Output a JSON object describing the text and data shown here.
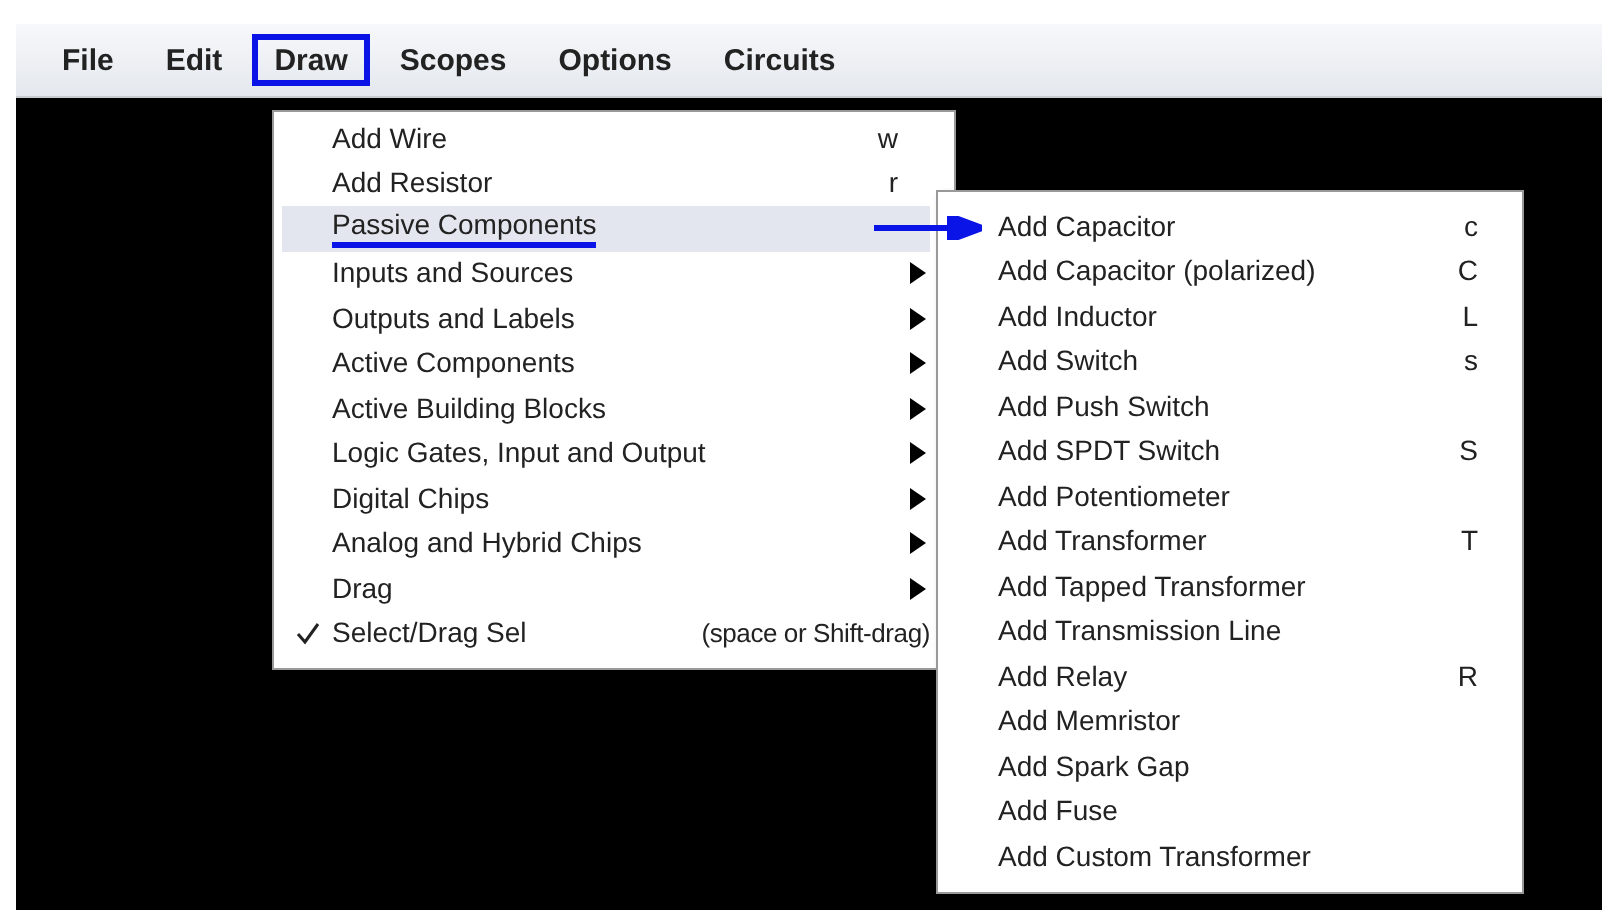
{
  "menubar": [
    {
      "label": "File",
      "selected": false
    },
    {
      "label": "Edit",
      "selected": false
    },
    {
      "label": "Draw",
      "selected": true
    },
    {
      "label": "Scopes",
      "selected": false
    },
    {
      "label": "Options",
      "selected": false
    },
    {
      "label": "Circuits",
      "selected": false
    }
  ],
  "draw_menu": [
    {
      "kind": "shortcut",
      "label": "Add Wire",
      "shortcut": "w",
      "selected": false
    },
    {
      "kind": "shortcut",
      "label": "Add Resistor",
      "shortcut": "r",
      "selected": false
    },
    {
      "kind": "submenu",
      "label": "Passive Components",
      "selected": true
    },
    {
      "kind": "submenu",
      "label": "Inputs and Sources",
      "selected": false
    },
    {
      "kind": "submenu",
      "label": "Outputs and Labels",
      "selected": false
    },
    {
      "kind": "submenu",
      "label": "Active Components",
      "selected": false
    },
    {
      "kind": "submenu",
      "label": "Active Building Blocks",
      "selected": false
    },
    {
      "kind": "submenu",
      "label": "Logic Gates, Input and Output",
      "selected": false
    },
    {
      "kind": "submenu",
      "label": "Digital Chips",
      "selected": false
    },
    {
      "kind": "submenu",
      "label": "Analog and Hybrid Chips",
      "selected": false
    },
    {
      "kind": "submenu",
      "label": "Drag",
      "selected": false
    },
    {
      "kind": "check",
      "label": "Select/Drag Sel",
      "shortcut": "(space or Shift-drag)",
      "checked": true,
      "selected": false
    }
  ],
  "passive_components_menu": [
    {
      "label": "Add Capacitor",
      "shortcut": "c"
    },
    {
      "label": "Add Capacitor (polarized)",
      "shortcut": "C"
    },
    {
      "label": "Add Inductor",
      "shortcut": "L"
    },
    {
      "label": "Add Switch",
      "shortcut": "s"
    },
    {
      "label": "Add Push Switch"
    },
    {
      "label": "Add SPDT Switch",
      "shortcut": "S"
    },
    {
      "label": "Add Potentiometer"
    },
    {
      "label": "Add Transformer",
      "shortcut": "T"
    },
    {
      "label": "Add Tapped Transformer"
    },
    {
      "label": "Add Transmission Line"
    },
    {
      "label": "Add Relay",
      "shortcut": "R"
    },
    {
      "label": "Add Memristor"
    },
    {
      "label": "Add Spark Gap"
    },
    {
      "label": "Add Fuse"
    },
    {
      "label": "Add Custom Transformer"
    }
  ]
}
